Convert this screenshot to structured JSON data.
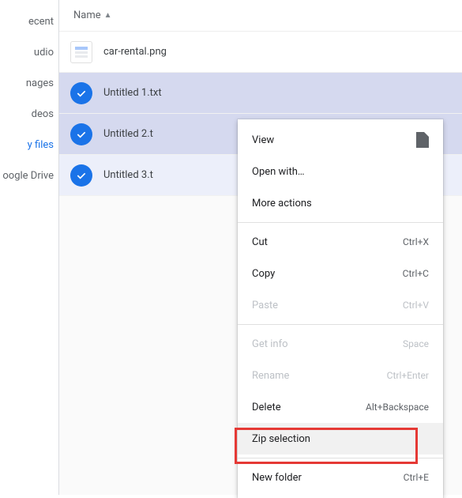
{
  "sidebar": {
    "items": [
      {
        "label": "ecent",
        "active": false
      },
      {
        "label": "udio",
        "active": false
      },
      {
        "label": "nages",
        "active": false
      },
      {
        "label": "deos",
        "active": false
      },
      {
        "label": "y files",
        "active": true
      },
      {
        "label": "oogle Drive",
        "active": false
      }
    ]
  },
  "header": {
    "name_label": "Name"
  },
  "rows": [
    {
      "name": "car-rental.png",
      "selected": false
    },
    {
      "name": "Untitled 1.txt",
      "selected": true,
      "shade": "deep"
    },
    {
      "name": "Untitled 2.t",
      "selected": true,
      "shade": "deep"
    },
    {
      "name": "Untitled 3.t",
      "selected": true,
      "shade": "light"
    }
  ],
  "menu": {
    "view": "View",
    "open_with": "Open with…",
    "more_actions": "More actions",
    "cut": "Cut",
    "cut_key": "Ctrl+X",
    "copy": "Copy",
    "copy_key": "Ctrl+C",
    "paste": "Paste",
    "paste_key": "Ctrl+V",
    "get_info": "Get info",
    "get_info_key": "Space",
    "rename": "Rename",
    "rename_key": "Ctrl+Enter",
    "delete": "Delete",
    "delete_key": "Alt+Backspace",
    "zip": "Zip selection",
    "new_folder": "New folder",
    "new_folder_key": "Ctrl+E"
  }
}
